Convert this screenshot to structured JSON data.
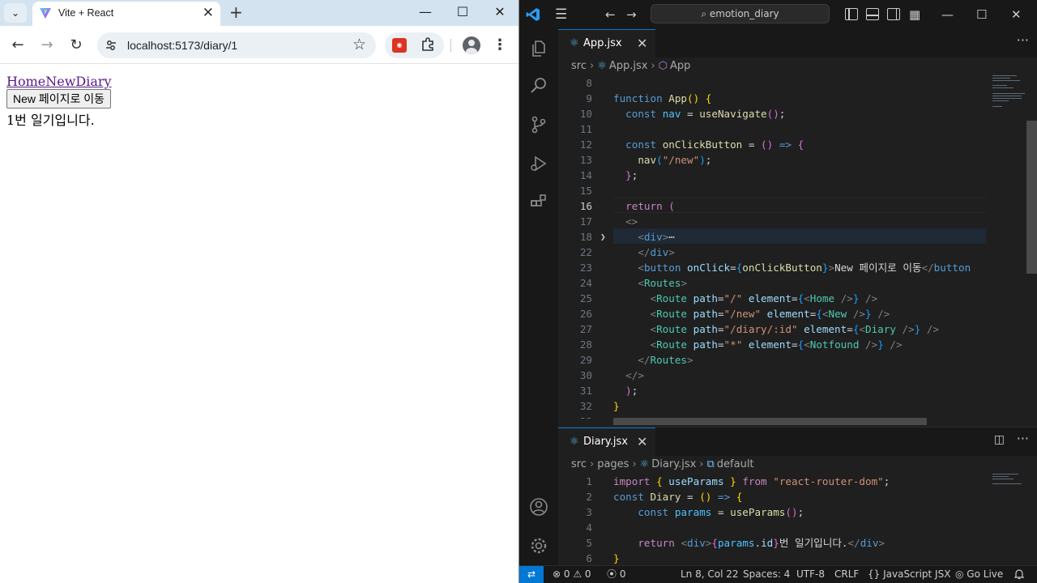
{
  "browser": {
    "tab_title": "Vite + React",
    "url": "localhost:5173/diary/1",
    "page": {
      "links": [
        "Home",
        "New",
        "Diary"
      ],
      "button_label": "New 페이지로 이동",
      "text": "1번 일기입니다."
    }
  },
  "vscode": {
    "search": "emotion_diary",
    "editor1": {
      "tab": "App.jsx",
      "breadcrumb": [
        "src",
        "App.jsx",
        "App"
      ]
    },
    "editor2": {
      "tab": "Diary.jsx",
      "breadcrumb": [
        "src",
        "pages",
        "Diary.jsx",
        "default"
      ]
    },
    "status": {
      "errors": "0",
      "warnings": "0",
      "ports": "0",
      "position": "Ln 8, Col 22",
      "spaces": "Spaces: 4",
      "encoding": "UTF-8",
      "eol": "CRLF",
      "language": "JavaScript JSX",
      "golive": "Go Live"
    }
  },
  "colors": {
    "accent": "#0078d4",
    "editor_bg": "#1f1f1f",
    "link": "#551a8b"
  }
}
